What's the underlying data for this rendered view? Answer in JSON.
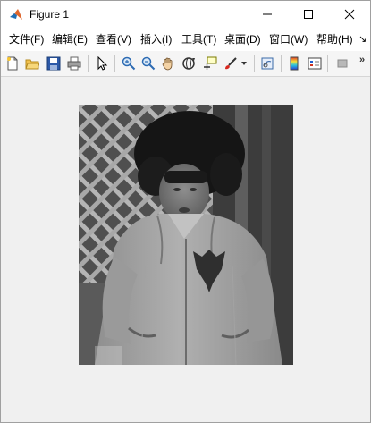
{
  "window": {
    "title": "Figure 1",
    "controls": {
      "minimize": "minimize",
      "maximize": "maximize",
      "close": "close"
    }
  },
  "menu": {
    "items": [
      {
        "label": "文件(F)"
      },
      {
        "label": "编辑(E)"
      },
      {
        "label": "查看(V)"
      },
      {
        "label": "插入(I)"
      },
      {
        "label": "工具(T)"
      },
      {
        "label": "桌面(D)"
      },
      {
        "label": "窗口(W)"
      },
      {
        "label": "帮助(H)"
      }
    ],
    "overflow": "↘"
  },
  "toolbar": {
    "overflow": "»",
    "buttons": [
      {
        "icon": "new-figure-icon"
      },
      {
        "icon": "open-folder-icon"
      },
      {
        "icon": "save-icon"
      },
      {
        "icon": "print-icon"
      },
      {
        "icon": "pointer-icon"
      },
      {
        "icon": "zoom-in-icon"
      },
      {
        "icon": "zoom-out-icon"
      },
      {
        "icon": "pan-hand-icon"
      },
      {
        "icon": "rotate-3d-icon"
      },
      {
        "icon": "data-cursor-icon"
      },
      {
        "icon": "brush-icon"
      },
      {
        "icon": "link-plot-icon"
      },
      {
        "icon": "colorbar-icon"
      },
      {
        "icon": "legend-icon"
      },
      {
        "icon": "plot-tools-icon"
      }
    ]
  },
  "figure": {
    "image": "grayscale photograph of a child in a jacket standing in front of a lattice fence",
    "colors": {
      "background": "#f0f0f0",
      "photo_dark": "#3a3a3a",
      "photo_light": "#bdbdbd"
    }
  }
}
